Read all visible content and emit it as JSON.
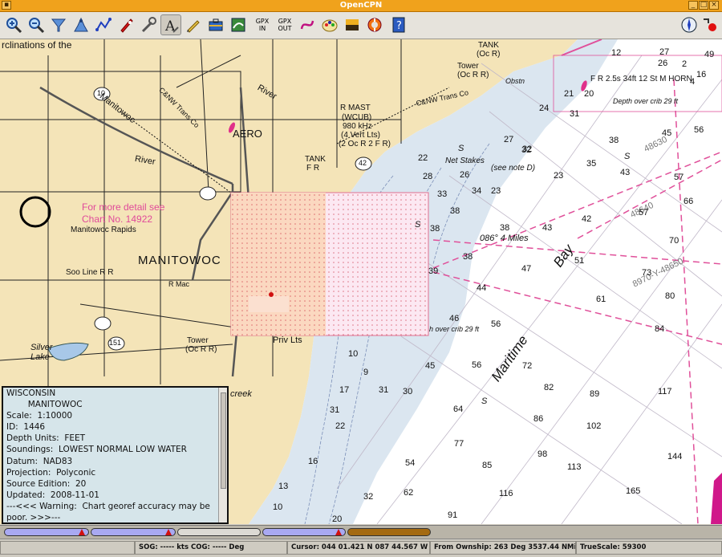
{
  "window": {
    "title": "OpenCPN"
  },
  "toolbar": {
    "gpx_in": "GPX IN",
    "gpx_out": "GPX OUT"
  },
  "chart": {
    "text_top_left": "rclinations of the",
    "town": "MANITOWOC",
    "aero": "AERO",
    "manitowoc_river": "Manitowoc",
    "river": "River",
    "river2": "River",
    "more_detail": "For more detail see",
    "chart_no": "Chart No. 14922",
    "manitowoc_rapids": "Manitowoc Rapids",
    "soo_line": "Soo Line R R",
    "r_mast": "R MAST",
    "wcub": "(WCUB)",
    "freq": "980 kHz",
    "vert_lts": "(4 Vert Lts)",
    "oc_r": "(2 Oc R 2 F R)",
    "tank1": "TANK",
    "tank1b": "F R",
    "tank2": "TANK",
    "tank2b": "(Oc R)",
    "tower1": "Tower",
    "tower1b": "(Oc R R)",
    "tower2": "Tower",
    "tower2b": "(Oc R R)",
    "cnw1": "C&NW Trans Co",
    "cnw2": "C&NW Trans Co",
    "net_stakes": "Net Stakes",
    "see_note": "(see note D)",
    "bearing": "086°   4 Miles",
    "bay": "Bay",
    "maritime": "Maritime",
    "range_line": "8970-Y-48650",
    "lor1": "48630",
    "lor2": "48640",
    "depth_over": "Depth over crib 29 ft",
    "depth_over2": "h over crib 29 ft",
    "lake": "Silver Lake",
    "creek": "creek",
    "priv_lts": "Priv Lts",
    "f_r_top": "F R 2.5s 34ft 12 St M HORN",
    "obstn": "Obstn",
    "r_mac": "R Mac",
    "route_10": "10",
    "route_42": "42",
    "route_151": "151",
    "s_marks": [
      "S",
      "S",
      "S",
      "S"
    ],
    "soundings": [
      {
        "v": "27"
      },
      {
        "v": "32"
      },
      {
        "v": "33"
      },
      {
        "v": "34"
      },
      {
        "v": "38"
      },
      {
        "v": "43"
      },
      {
        "v": "42"
      },
      {
        "v": "38"
      },
      {
        "v": "47"
      },
      {
        "v": "51"
      },
      {
        "v": "44"
      },
      {
        "v": "57"
      },
      {
        "v": "61"
      },
      {
        "v": "46"
      },
      {
        "v": "56"
      },
      {
        "v": "70"
      },
      {
        "v": "84"
      },
      {
        "v": "45"
      },
      {
        "v": "56"
      },
      {
        "v": "72"
      },
      {
        "v": "82"
      },
      {
        "v": "89"
      },
      {
        "v": "117"
      },
      {
        "v": "64"
      },
      {
        "v": "86"
      },
      {
        "v": "102"
      },
      {
        "v": "77"
      },
      {
        "v": "98"
      },
      {
        "v": "113"
      },
      {
        "v": "144"
      },
      {
        "v": "85"
      },
      {
        "v": "116"
      },
      {
        "v": "165"
      },
      {
        "v": "62"
      },
      {
        "v": "91"
      },
      {
        "v": "54"
      },
      {
        "v": "32"
      },
      {
        "v": "13"
      },
      {
        "v": "10"
      },
      {
        "v": "16"
      },
      {
        "v": "22"
      },
      {
        "v": "17"
      },
      {
        "v": "10"
      },
      {
        "v": "9"
      },
      {
        "v": "31"
      },
      {
        "v": "30"
      },
      {
        "v": "23"
      },
      {
        "v": "28"
      },
      {
        "v": "22"
      },
      {
        "v": "24"
      },
      {
        "v": "31"
      },
      {
        "v": "32"
      },
      {
        "v": "38"
      },
      {
        "v": "45"
      },
      {
        "v": "56"
      },
      {
        "v": "35"
      },
      {
        "v": "43"
      },
      {
        "v": "57"
      },
      {
        "v": "66"
      },
      {
        "v": "73"
      },
      {
        "v": "80"
      },
      {
        "v": "38"
      },
      {
        "v": "39"
      },
      {
        "v": "27"
      },
      {
        "v": "49"
      },
      {
        "v": "12"
      },
      {
        "v": "16"
      },
      {
        "v": "20"
      },
      {
        "v": "23"
      },
      {
        "v": "26"
      },
      {
        "v": "21"
      },
      {
        "v": "26"
      },
      {
        "v": "2"
      },
      {
        "v": "4"
      },
      {
        "v": "38"
      },
      {
        "v": "20"
      },
      {
        "v": "31"
      }
    ]
  },
  "info_panel": {
    "lines": [
      "WISCONSIN",
      "        MANITOWOC",
      "Scale:  1:10000",
      "ID:  1446",
      "Depth Units:  FEET",
      "Soundings:  LOWEST NORMAL LOW WATER",
      "Datum:  NAD83",
      "Projection:  Polyconic",
      "Source Edition:  20",
      "Updated:  2008-11-01",
      "---<<< Warning:  Chart georef accuracy may be",
      "poor. >>>---"
    ]
  },
  "status": {
    "sog": "SOG: ----- kts  COG: ----- Deg",
    "cursor": "Cursor: 044 01.421 N 087 44.567 W",
    "from_ownship": "From Ownship: 263 Deg  3537.44 NMi",
    "truescale": "TrueScale:    59300"
  }
}
